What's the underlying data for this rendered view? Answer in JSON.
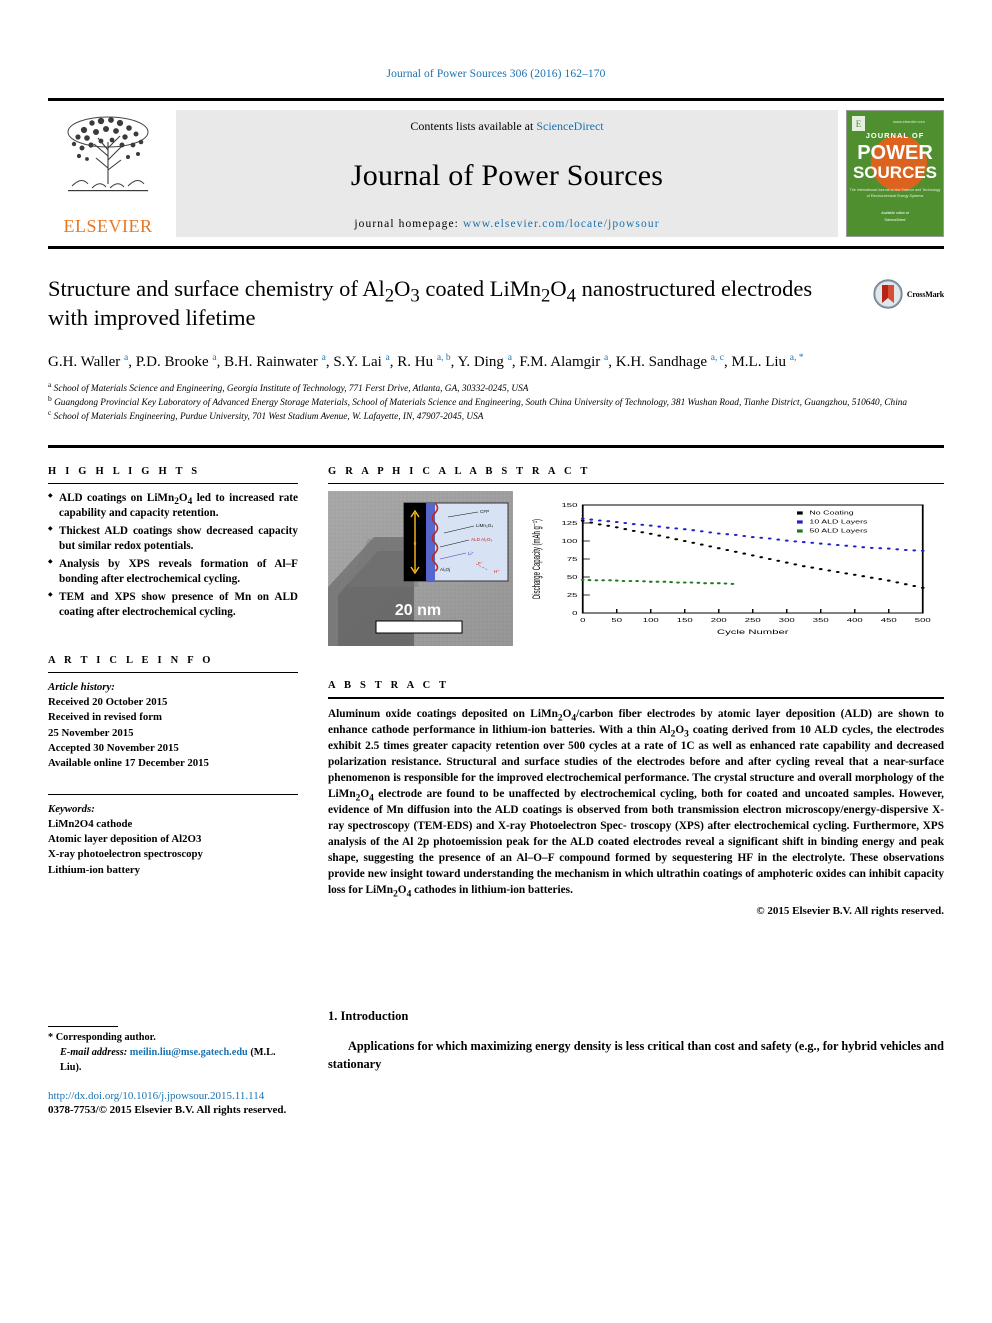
{
  "running_head": "Journal of Power Sources 306 (2016) 162–170",
  "masthead": {
    "contents_prefix": "Contents lists available at ",
    "sciencedirect": "ScienceDirect",
    "journal_title": "Journal of Power Sources",
    "homepage_prefix": "journal homepage: ",
    "homepage_url": "www.elsevier.com/locate/jpowsour",
    "publisher": "ELSEVIER",
    "cover_line1": "JOURNAL OF",
    "cover_line2": "POWER",
    "cover_line3": "SOURCES",
    "cover_color": "#4f8f2f"
  },
  "article": {
    "title_line1": "Structure and surface chemistry of Al",
    "title_html": "Structure and surface chemistry of Al₂O₃ coated LiMn₂O₄ nanostructured electrodes with improved lifetime",
    "crossmark_label": "CrossMark",
    "authors": [
      {
        "name": "G.H. Waller",
        "marks": "a"
      },
      {
        "name": "P.D. Brooke",
        "marks": "a"
      },
      {
        "name": "B.H. Rainwater",
        "marks": "a"
      },
      {
        "name": "S.Y. Lai",
        "marks": "a"
      },
      {
        "name": "R. Hu",
        "marks": "a, b"
      },
      {
        "name": "Y. Ding",
        "marks": "a"
      },
      {
        "name": "F.M. Alamgir",
        "marks": "a"
      },
      {
        "name": "K.H. Sandhage",
        "marks": "a, c"
      },
      {
        "name": "M.L. Liu",
        "marks": "a, *"
      }
    ],
    "affiliations": [
      {
        "mark": "a",
        "text": "School of Materials Science and Engineering, Georgia Institute of Technology, 771 Ferst Drive, Atlanta, GA, 30332-0245, USA"
      },
      {
        "mark": "b",
        "text": "Guangdong Provincial Key Laboratory of Advanced Energy Storage Materials, School of Materials Science and Engineering, South China University of Technology, 381 Wushan Road, Tianhe District, Guangzhou, 510640, China"
      },
      {
        "mark": "c",
        "text": "School of Materials Engineering, Purdue University, 701 West Stadium Avenue, W. Lafayette, IN, 47907-2045, USA"
      }
    ]
  },
  "highlights": {
    "heading": "H I G H L I G H T S",
    "items": [
      "ALD coatings on LiMn₂O₄ led to increased rate capability and capacity retention.",
      "Thickest ALD coatings show decreased capacity but similar redox potentials.",
      "Analysis by XPS reveals formation of Al–F bonding after electrochemical cycling.",
      "TEM and XPS show presence of Mn on ALD coating after electrochemical cycling."
    ]
  },
  "article_info": {
    "heading": "A R T I C L E   I N F O",
    "history_label": "Article history:",
    "history": [
      "Received 20 October 2015",
      "Received in revised form",
      "25 November 2015",
      "Accepted 30 November 2015",
      "Available online 17 December 2015"
    ],
    "keywords_label": "Keywords:",
    "keywords": [
      "LiMn2O4 cathode",
      "Atomic layer deposition of Al2O3",
      "X-ray photoelectron spectroscopy",
      "Lithium-ion battery"
    ]
  },
  "graphical_abstract": {
    "heading": "G R A P H I C A L   A B S T R A C T",
    "tem_scale_bar": "20 nm",
    "schematic_labels": [
      "CFP",
      "LiMn₂O₄",
      "ALD Al₂O₃",
      "Li⁺",
      "AlₓOᵧ",
      "F⁻",
      "H⁺",
      "e⁻"
    ]
  },
  "chart_data": {
    "type": "scatter",
    "title": "",
    "xlabel": "Cycle Number",
    "ylabel": "Discharge Capacity (mAh g⁻¹)",
    "xlim": [
      0,
      500
    ],
    "ylim": [
      0,
      150
    ],
    "xticks": [
      0,
      50,
      100,
      150,
      200,
      250,
      300,
      350,
      400,
      450,
      500
    ],
    "yticks": [
      0,
      25,
      50,
      75,
      100,
      125,
      150
    ],
    "grid": false,
    "legend_position": "top-right",
    "series": [
      {
        "name": "No Coating",
        "color": "#000000",
        "x": [
          0,
          25,
          50,
          75,
          100,
          125,
          150,
          175,
          200,
          225,
          250,
          275,
          300,
          325,
          350,
          375,
          400,
          425,
          450,
          475,
          500
        ],
        "values": [
          128,
          123,
          119,
          114,
          110,
          105,
          100,
          95,
          90,
          85,
          80,
          75,
          70,
          65,
          61,
          57,
          53,
          49,
          45,
          40,
          35
        ]
      },
      {
        "name": "10 ALD Layers",
        "color": "#2222cc",
        "x": [
          0,
          25,
          50,
          75,
          100,
          125,
          150,
          175,
          200,
          225,
          250,
          275,
          300,
          325,
          350,
          375,
          400,
          425,
          450,
          475,
          500
        ],
        "values": [
          131,
          128,
          126,
          123,
          121,
          118,
          116,
          113,
          110,
          108,
          105,
          103,
          100,
          98,
          96,
          94,
          92,
          90,
          89,
          87,
          86
        ]
      },
      {
        "name": "50 ALD Layers",
        "color": "#1d7a1d",
        "x": [
          0,
          20,
          40,
          60,
          80,
          100,
          120,
          140,
          160,
          180,
          200,
          220
        ],
        "values": [
          46,
          45,
          45,
          44,
          44,
          43,
          43,
          42,
          42,
          41,
          41,
          40
        ]
      }
    ]
  },
  "abstract": {
    "heading": "A B S T R A C T",
    "paragraphs": [
      "Aluminum oxide coatings deposited on LiMn₂O₄/carbon fiber electrodes by atomic layer deposition (ALD) are shown to enhance cathode performance in lithium-ion batteries. With a thin Al₂O₃ coating derived from 10 ALD cycles, the electrodes exhibit 2.5 times greater capacity retention over 500 cycles at a rate of 1C as well as enhanced rate capability and decreased polarization resistance. Structural and surface studies of the electrodes before and after cycling reveal that a near-surface phenomenon is responsible for the improved electrochemical performance. The crystal structure and overall morphology of the LiMn₂O₄ electrode are found to be unaffected by electrochemical cycling, both for coated and uncoated samples. However, evidence of Mn diffusion into the ALD coatings is observed from both transmission electron microscopy/energy-dispersive X-ray spectroscopy (TEM-EDS) and X-ray Photoelectron Spectroscopy (XPS) after electrochemical cycling. Furthermore, XPS analysis of the Al 2p photoemission peak for the ALD coated electrodes reveal a significant shift in binding energy and peak shape, suggesting the presence of an Al–O–F compound formed by sequestering HF in the electrolyte. These observations provide new insight toward understanding the mechanism in which ultrathin coatings of amphoteric oxides can inhibit capacity loss for LiMn₂O₄ cathodes in lithium-ion batteries."
    ],
    "copyright": "© 2015 Elsevier B.V. All rights reserved."
  },
  "introduction": {
    "heading": "1. Introduction",
    "paragraph": "Applications for which maximizing energy density is less critical than cost and safety (e.g., for hybrid vehicles and stationary"
  },
  "footer": {
    "corresponding_marker": "*",
    "corresponding_label": "Corresponding author.",
    "email_label": "E-mail address:",
    "email": "meilin.liu@mse.gatech.edu",
    "email_owner": "(M.L. Liu).",
    "doi": "http://dx.doi.org/10.1016/j.jpowsour.2015.11.114",
    "issn": "0378-7753/© 2015 Elsevier B.V. All rights reserved."
  }
}
